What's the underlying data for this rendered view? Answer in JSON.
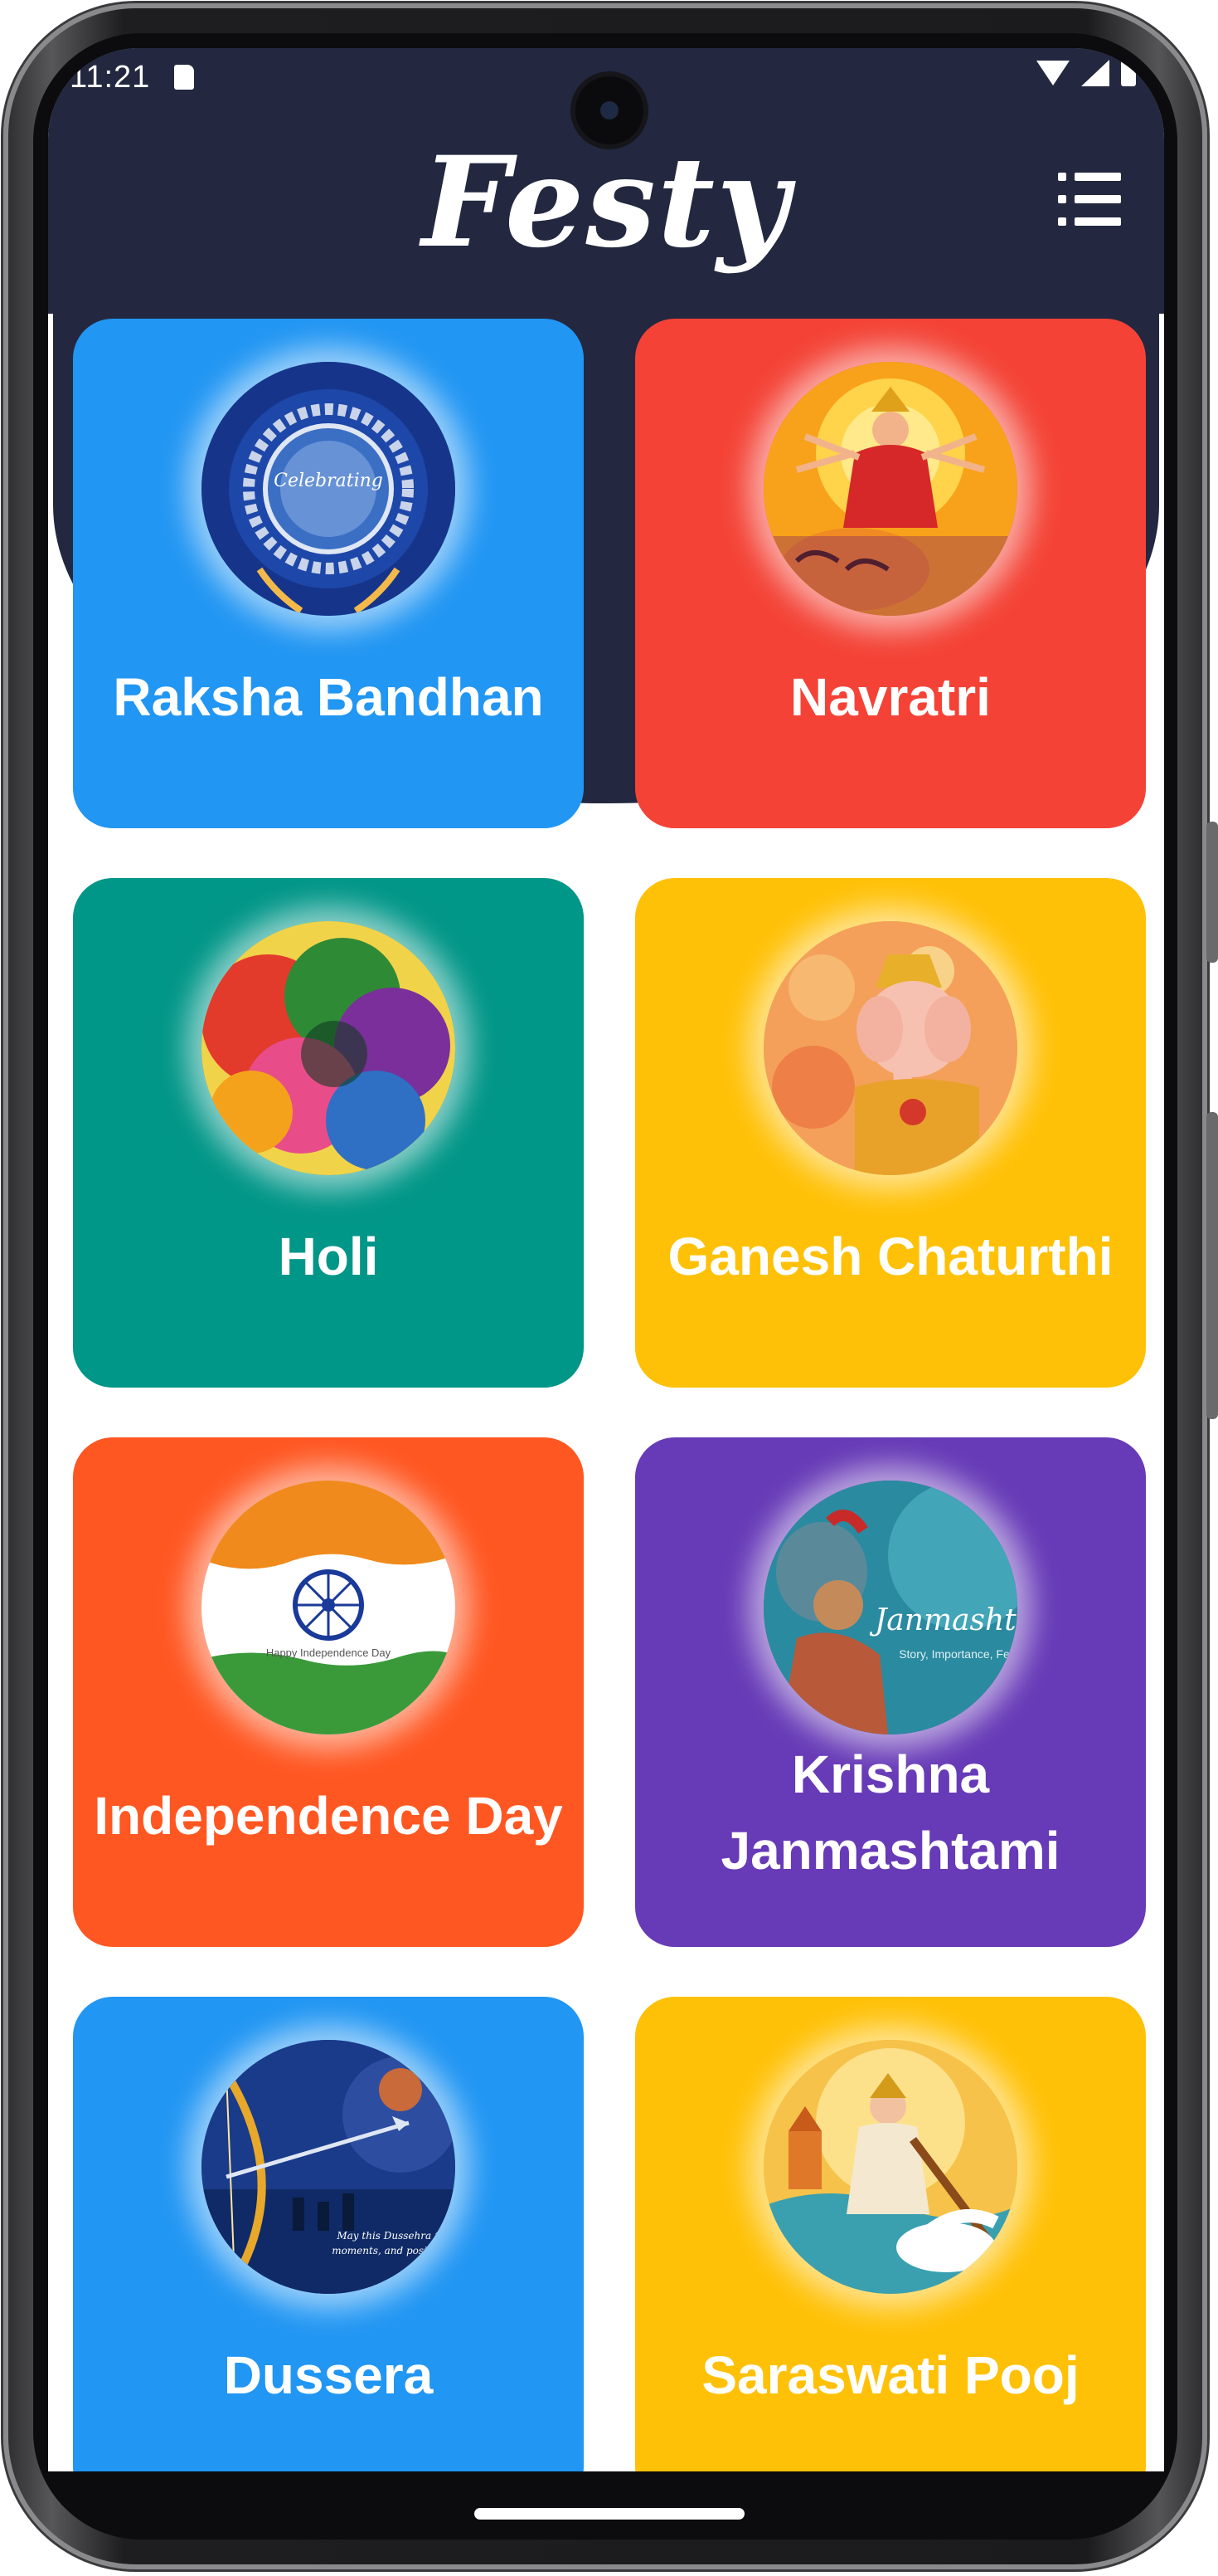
{
  "status_bar": {
    "time": "11:21"
  },
  "header": {
    "app_title": "Festy",
    "menu_icon": "list-menu-icon"
  },
  "theme": {
    "header_bg": "#232840"
  },
  "festivals": [
    {
      "label": "Raksha Bandhan",
      "color": "#2196F3",
      "image": "rakhi-image"
    },
    {
      "label": "Navratri",
      "color": "#F44336",
      "image": "durga-image"
    },
    {
      "label": "Holi",
      "color": "#009688",
      "image": "holi-colors-image"
    },
    {
      "label": "Ganesh Chaturthi",
      "color": "#FFC107",
      "image": "ganesha-image"
    },
    {
      "label": "Independence Day",
      "color": "#FF5722",
      "image": "indian-flag-image"
    },
    {
      "label": "Krishna Janmashtami",
      "color": "#673AB7",
      "image": "krishna-image"
    },
    {
      "label": "Dussera",
      "color": "#2196F3",
      "image": "dussera-bow-image"
    },
    {
      "label": "Saraswati Pooj",
      "color": "#FFC107",
      "image": "saraswati-image"
    }
  ],
  "image_texts": {
    "rakhi": "Celebrating",
    "flag": "Happy Independence Day",
    "krishna": "Janmashta",
    "krishna_sub": "Story, Importance, Fe",
    "dussera": "May this Dussehra fill",
    "dussera_sub": "moments, and positivity"
  }
}
